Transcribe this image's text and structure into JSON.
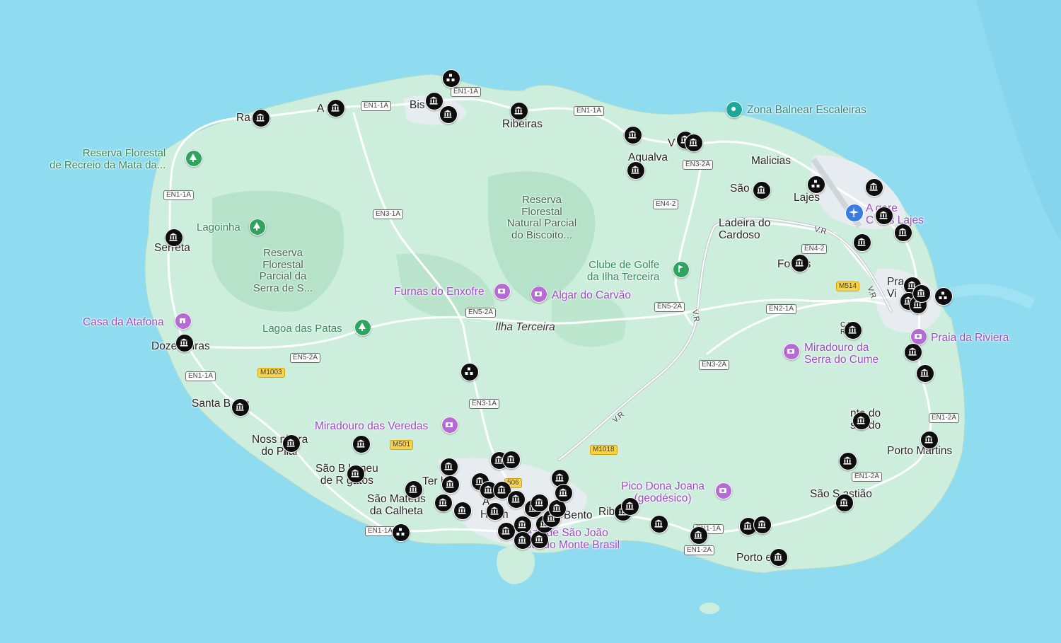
{
  "map": {
    "island_label": "Ilha Terceira",
    "towns": {
      "raminho": "Ra    ho",
      "altares": "A    es",
      "biscoitos": "Bis        s",
      "quatro_ribeiras_1": "    ro",
      "quatro_ribeiras_2": "Ribeiras",
      "agualva": "Agualva",
      "vila_nova": "V          ova",
      "malicias": "Malicias",
      "sao_bras": "São     s",
      "lajes": "Lajes",
      "ladeira_1": "Ladeira do",
      "ladeira_2": "Cardoso",
      "fontinhas": "Fo      has",
      "serreta": "Serreta",
      "doze_ribeiras": "Doze     beiras",
      "santa_barbara": "Santa B      ara",
      "nossa_senhora_1": "Noss      nhora",
      "nossa_senhora_2": "do Pilar",
      "sao_bartolomeu_1": "São B      lomeu",
      "sao_bartolomeu_2": "de R       gatos",
      "sao_mateus_1": "São Mateus",
      "sao_mateus_2": "da Calheta",
      "terra_cha": "Ter        ha",
      "angra_1": "A",
      "angra_2": "H     ism",
      "sao_bento": "Bento",
      "ribeirinha": "Rib         na",
      "praia_1": "Pra    a",
      "praia_2": "Vi",
      "cabo_praia_1": "C       DA",
      "cabo_praia_2": "RA",
      "fonte_bastardo_1": "    nte do",
      "fonte_bastardo_2": "    stardo",
      "porto_martins": "Porto Martins",
      "sao_sebastiao": "São S     astião",
      "porto_judeu": "Porto      eu"
    },
    "parks": {
      "mata_da_serreta_1": "Reserva Florestal",
      "mata_da_serreta_2": "de Recreio da Mata da...",
      "lagoinha": "Lagoinha",
      "serra_santa_barbara": [
        "Reserva",
        "Florestal",
        "Parcial da",
        "Serra de S..."
      ],
      "biscoito": [
        "Reserva",
        "Florestal",
        "Natural Parcial",
        "do Biscoito..."
      ],
      "lagoa_patas": "Lagoa das Patas",
      "clube_golfe_1": "Clube de Golfe",
      "clube_golfe_2": "da Ilha Terceira"
    },
    "attractions": {
      "zona_balnear": "Zona Balnear Escaleiras",
      "furnas": "Furnas do Enxofre",
      "algar": "Algar do Carvão",
      "casa_atafona": "Casa da Atafona",
      "miradouro_veredas": "Miradouro das Veredas",
      "pico_dona_joana_1": "Pico Dona Joana",
      "pico_dona_joana_2": "(geodésico)",
      "fortaleza_1": "     leza de São João",
      "fortaleza_2": "      ista do Monte Brasil",
      "praia_riviera": "Praia da Riviera",
      "miradouro_cume_1": "Miradouro da",
      "miradouro_cume_2": "Serra do Cume",
      "aerogare_1": "A      gare",
      "aerogare_2": "C      das Lajes"
    },
    "road_shields": {
      "en1a_1": "EN1-1A",
      "en1a_2": "EN1-1A",
      "en1a_3": "EN1-1A",
      "en1a_4": "EN1-1A",
      "en1a_5": "EN1-1A",
      "en1a_6": "EN1-1A",
      "en1a_7": "EN1-1A",
      "en1a_8": "EN1-1A",
      "en3a_1": "EN3-1A",
      "en3a_2": "EN3-1A",
      "en32a_1": "EN3-2A",
      "en32a_2": "EN3-2A",
      "en42_1": "EN4-2",
      "en42_2": "EN4-2",
      "en52a_1": "EN5-2A",
      "en52a_2": "EN5-2A",
      "en52a_3": "EN5-2A",
      "en21a": "EN2-1A",
      "en12a_1": "EN1-2A",
      "en12a_2": "EN1-2A",
      "en12a_3": "EN1-2A",
      "m1003": "M1003",
      "m501": "M501",
      "m1018": "M1018",
      "m514": "M514",
      "m506": "506",
      "vr_1": "V.R",
      "vr_2": "V.R",
      "vr_3": "V.R",
      "vr_4": "V.R"
    },
    "icons": {
      "museum_marker": "museum-icon",
      "fort_marker": "fort-icon",
      "landmark_marker": "landmark-icon",
      "airport_marker": "airplane-icon",
      "camera_marker": "camera-icon",
      "tree_marker": "tree-icon",
      "golf_marker": "golf-icon",
      "beach_marker": "pin-dot-icon"
    },
    "colors": {
      "sea": "#8fdbf0",
      "land": "#cdeedd",
      "park": "#aedec2",
      "urban": "#e8eef2",
      "marker": "#0d0d0d",
      "attraction": "#9a49c9",
      "nature_label": "#2f8a58"
    }
  }
}
